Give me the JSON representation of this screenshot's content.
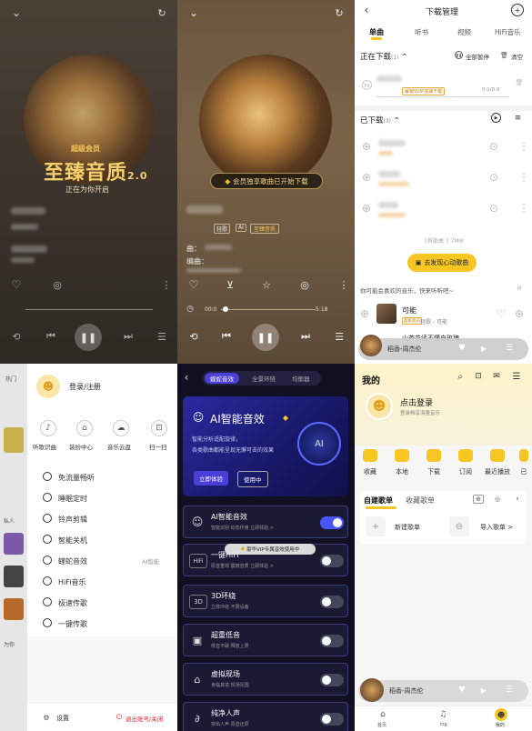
{
  "p1": {
    "vip_label": "超级会员",
    "title": "至臻音质",
    "title_ver": "2.0",
    "subtitle": "正在为你开启",
    "badge": "至臻音质"
  },
  "p2": {
    "toast": "会员独享歌曲已开始下载",
    "tag1": "轻歌",
    "tag2": "AI",
    "tag3": "至臻音质",
    "meta1": "曲：",
    "meta2": "编曲：",
    "time_cur": "00:0",
    "time_total": "5:18"
  },
  "p3": {
    "title": "下载管理",
    "tabs": [
      "单曲",
      "听书",
      "视频",
      "HiFi音乐"
    ],
    "downloading": "正在下载",
    "downloading_count": "(1)",
    "pause_all": "全部暂停",
    "clear": "清空",
    "speed_badge": "解锁SVIP加速下载",
    "progress_text": "0.0/0.0",
    "downloaded": "已下载",
    "downloaded_count": "(3)",
    "songs_count": "3首歌曲 7.7MM",
    "discover_btn": "去发现心动歌曲",
    "recommend": "你可能会喜欢的音乐，快来听听吧~",
    "rec_title": "可能",
    "rec_tag": "超级会员",
    "rec_artist": "轻歌 - 可能",
    "rec2_title": "山茶花读不懂白玫瑰",
    "mini_song": "稻香-周杰伦"
  },
  "p4": {
    "login": "登录/注册",
    "grid": [
      "听歌识曲",
      "装扮中心",
      "音乐云盘",
      "扫一扫"
    ],
    "menu": [
      "免流量畅听",
      "睡眠定时",
      "铃声剪辑",
      "智能关机",
      "蝰蛇音效",
      "HiFi音乐",
      "极速传歌",
      "一键传歌"
    ],
    "menu_right": "AI智能",
    "settings": "设置",
    "logout": "退出账号/关闭",
    "bg_labels": [
      "热门",
      "私人",
      "为你"
    ]
  },
  "p5": {
    "tabs": [
      "蝰蛇音效",
      "全景环绕",
      "均衡器"
    ],
    "hero_title": "AI智能音效",
    "hero_desc1": "智能分析适配旋律，",
    "hero_desc2": "各类歌曲都能呈现无懈可击的效果",
    "try_btn": "立即体验",
    "using_btn": "使用中",
    "ai_badge": "AI",
    "items": [
      {
        "name": "AI智能音效",
        "desc": "智能识别 动态作用 立即体验 >",
        "on": true
      },
      {
        "name": "一键HiFi",
        "desc": "原音重现 震撼音质 立即体验 >",
        "on": false
      },
      {
        "name": "3D环绕",
        "desc": "立体环绕 不限设备",
        "on": false
      },
      {
        "name": "超重低音",
        "desc": "低音不破 释放上限",
        "on": false
      },
      {
        "name": "虚拟现场",
        "desc": "身临其境 现场氛围",
        "on": false
      },
      {
        "name": "纯净人声",
        "desc": "突出人声 原音还原",
        "on": false
      }
    ],
    "vip_toast": "豪华VIP专属音效使用中",
    "hifi_badge": "HiFi",
    "d3_badge": "3D"
  },
  "p6": {
    "title": "我的",
    "login": "点击登录",
    "login_sub": "登录畅享海量音乐",
    "quick": [
      "收藏",
      "本地",
      "下载",
      "订阅",
      "最近播放",
      "已"
    ],
    "tab1": "自建歌单",
    "tab2": "收藏歌单",
    "new_list": "新建歌单",
    "import_list": "导入歌单 >",
    "mini_song": "稻香-周杰伦",
    "nav": [
      "首页",
      "ing",
      "我的"
    ]
  },
  "colors": {
    "accent": "#f7c623",
    "gold": "#f2c45a",
    "purple": "#4a3fd6",
    "toggle_on": "#4b55ff"
  }
}
